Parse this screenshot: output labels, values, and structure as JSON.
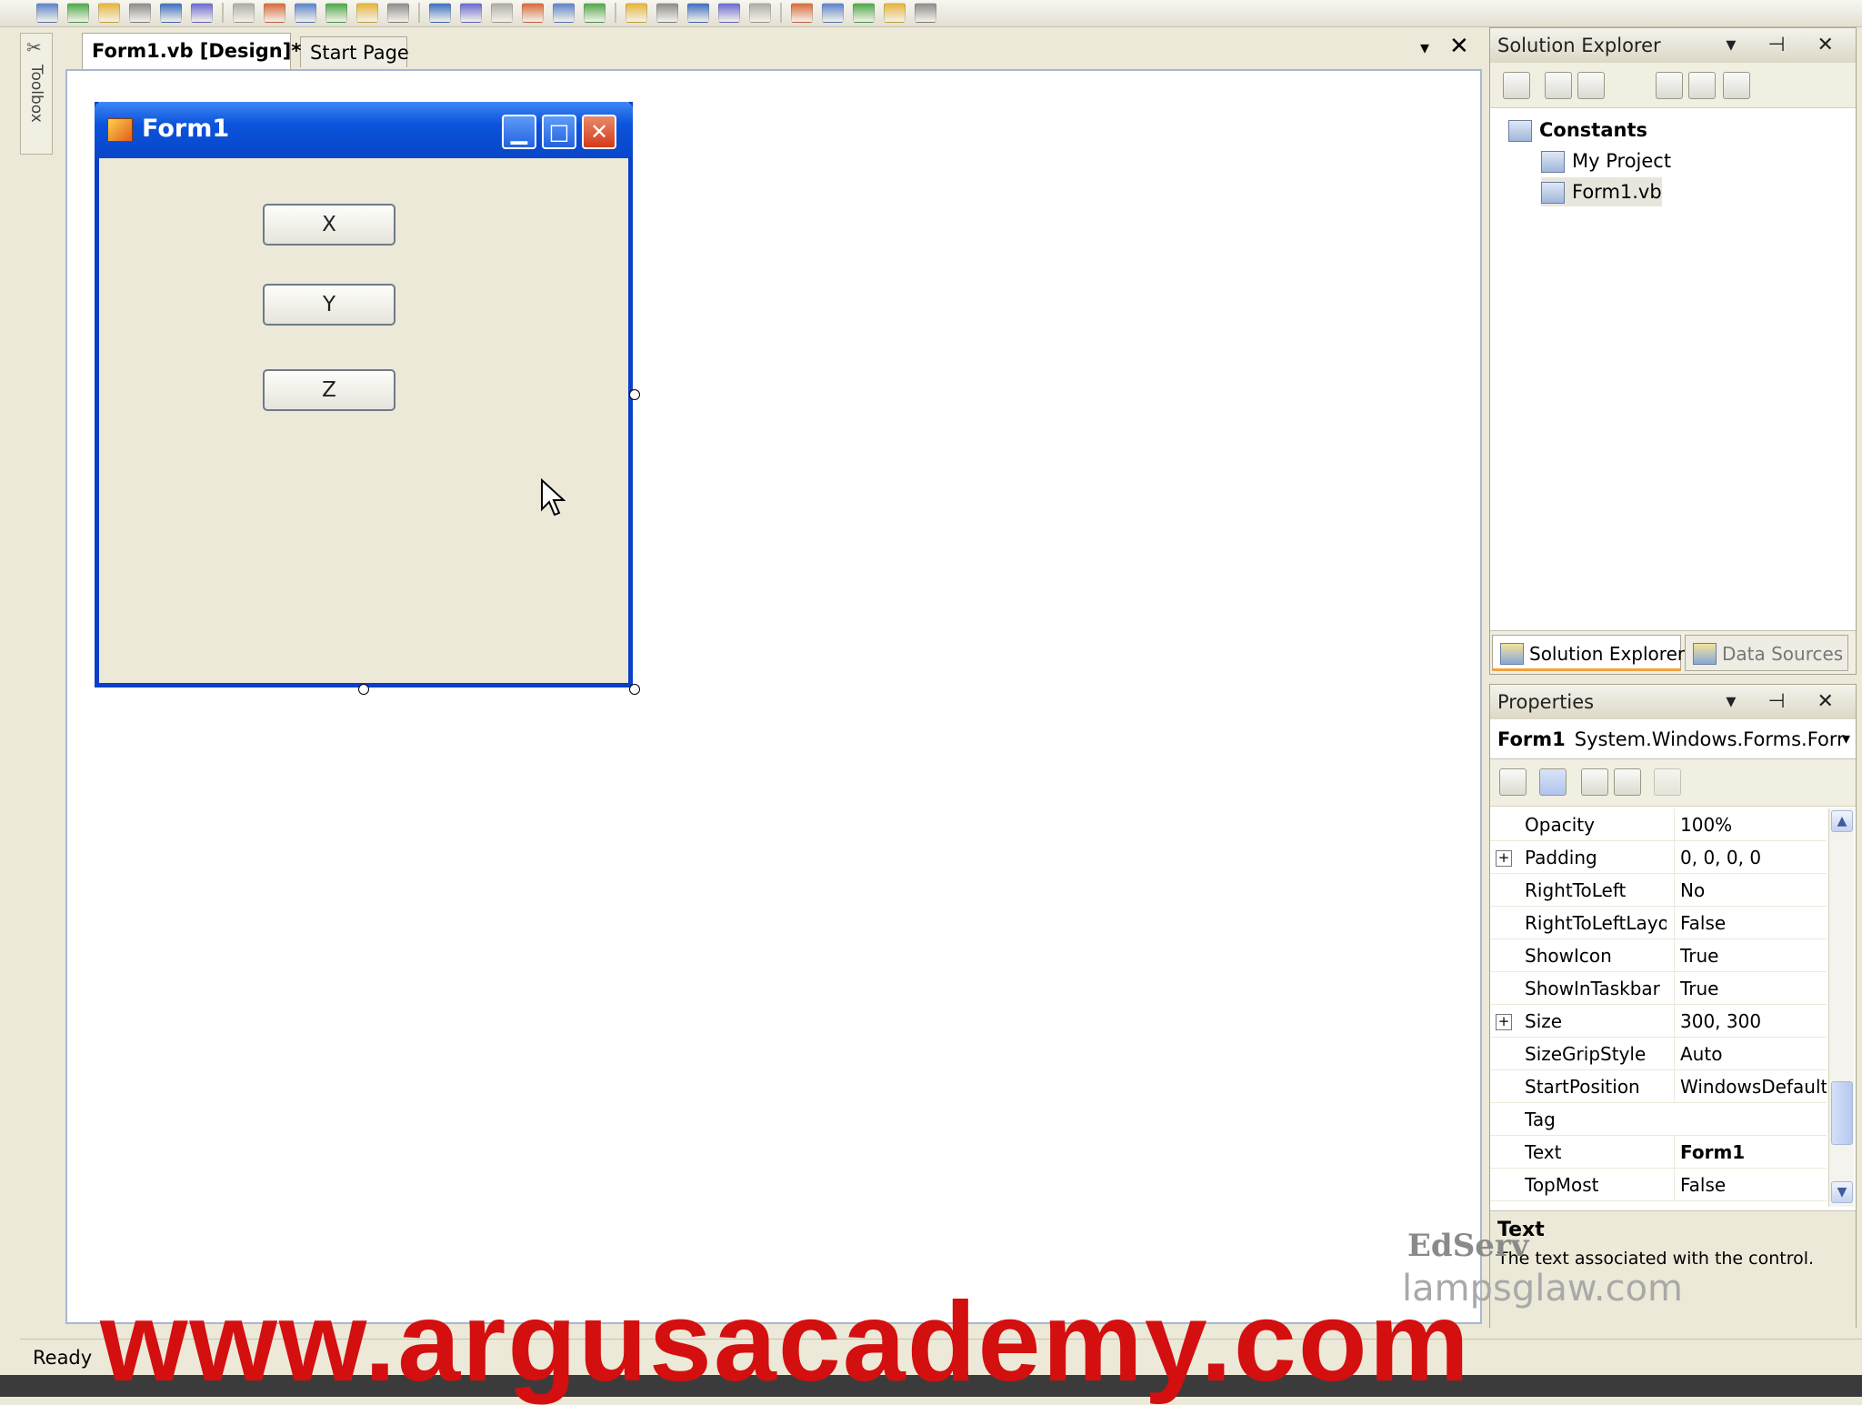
{
  "toolbar": {
    "icon_count": 28
  },
  "toolbox": {
    "label": "Toolbox"
  },
  "doc_tabs": [
    {
      "label": "Form1.vb [Design]*"
    },
    {
      "label": "Start Page"
    }
  ],
  "doc_controls": {
    "arrow": "▾",
    "close": "✕"
  },
  "form1": {
    "title": "Form1",
    "buttons": [
      "X",
      "Y",
      "Z"
    ],
    "controls": {
      "minimize": "▁",
      "maximize": "□",
      "close": "✕"
    }
  },
  "solution_explorer": {
    "title": "Solution Explorer",
    "pane_buttons": "▾ ⊣ ✕",
    "tree": [
      {
        "label": "Constants",
        "bold": true
      },
      {
        "label": "My Project"
      },
      {
        "label": "Form1.vb"
      }
    ],
    "tabs": [
      "Solution Explorer",
      "Data Sources"
    ]
  },
  "properties": {
    "title": "Properties",
    "pane_buttons": "▾ ⊣ ✕",
    "object_name": "Form1",
    "object_type": "System.Windows.Forms.Forr",
    "object_arrow": "▾",
    "rows": [
      {
        "name": "Opacity",
        "value": "100%"
      },
      {
        "name": "Padding",
        "value": "0, 0, 0, 0",
        "expand": "+"
      },
      {
        "name": "RightToLeft",
        "value": "No"
      },
      {
        "name": "RightToLeftLayo",
        "value": "False"
      },
      {
        "name": "ShowIcon",
        "value": "True"
      },
      {
        "name": "ShowInTaskbar",
        "value": "True"
      },
      {
        "name": "Size",
        "value": "300, 300",
        "expand": "+"
      },
      {
        "name": "SizeGripStyle",
        "value": "Auto"
      },
      {
        "name": "StartPosition",
        "value": "WindowsDefaultL"
      },
      {
        "name": "Tag",
        "value": ""
      },
      {
        "name": "Text",
        "value": "Form1",
        "bold": true
      },
      {
        "name": "TopMost",
        "value": "False"
      }
    ],
    "scroll": {
      "up": "▲",
      "down": "▼"
    },
    "description": {
      "title": "Text",
      "text": "The text associated with the control."
    }
  },
  "watermarks": {
    "edserv": "EdServ",
    "lamp": "lampsglaw.com",
    "site": "www.argusacademy.com"
  },
  "status": {
    "text": "Ready"
  }
}
